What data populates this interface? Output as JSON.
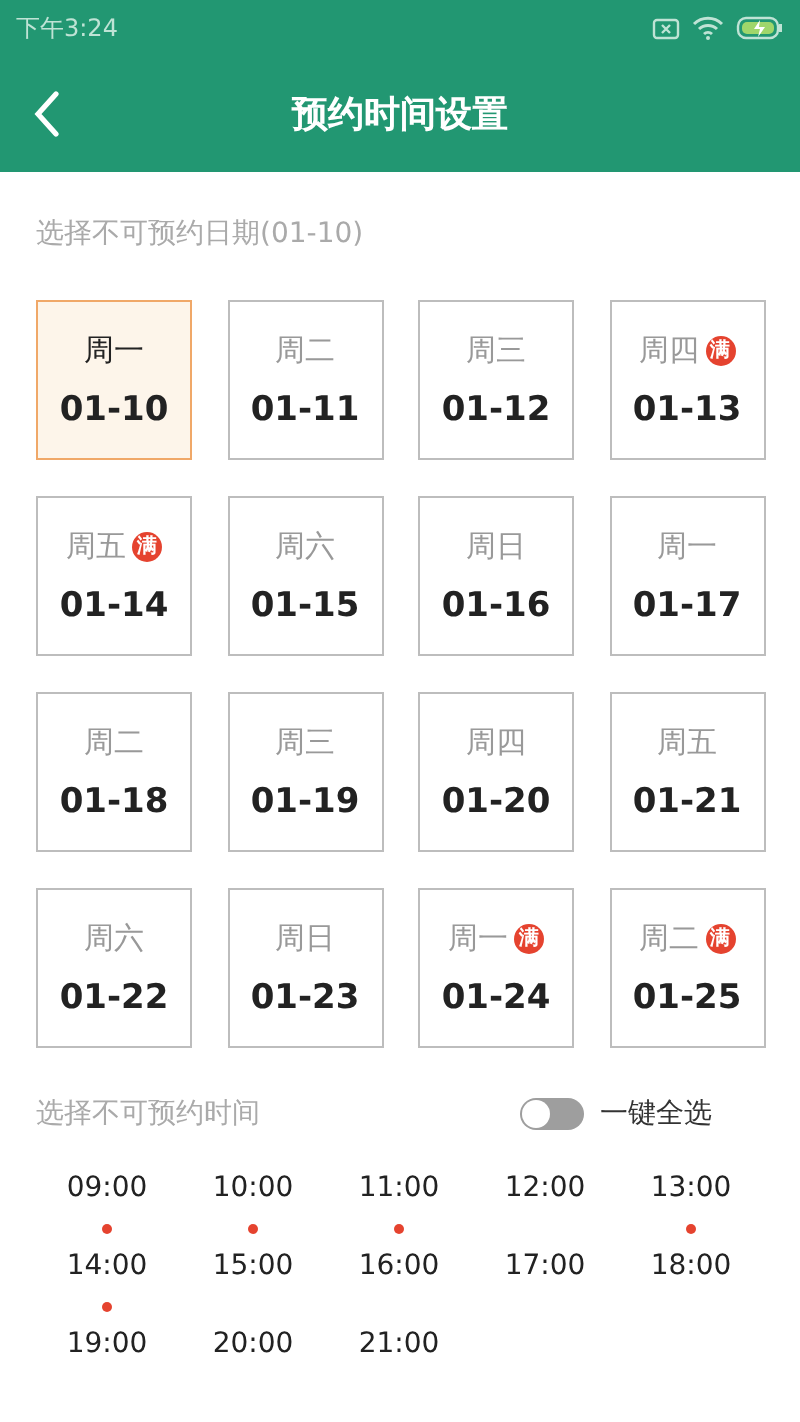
{
  "status_bar": {
    "time": "下午3:24"
  },
  "header": {
    "title": "预约时间设置"
  },
  "date_section": {
    "label": "选择不可预约日期(01-10)"
  },
  "dates": [
    {
      "weekday": "周一",
      "date": "01-10",
      "selected": true
    },
    {
      "weekday": "周二",
      "date": "01-11",
      "selected": false
    },
    {
      "weekday": "周三",
      "date": "01-12",
      "selected": false
    },
    {
      "weekday": "周四",
      "date": "01-13",
      "selected": false,
      "badge": "满"
    },
    {
      "weekday": "周五",
      "date": "01-14",
      "selected": false,
      "badge": "满"
    },
    {
      "weekday": "周六",
      "date": "01-15",
      "selected": false
    },
    {
      "weekday": "周日",
      "date": "01-16",
      "selected": false
    },
    {
      "weekday": "周一",
      "date": "01-17",
      "selected": false
    },
    {
      "weekday": "周二",
      "date": "01-18",
      "selected": false
    },
    {
      "weekday": "周三",
      "date": "01-19",
      "selected": false
    },
    {
      "weekday": "周四",
      "date": "01-20",
      "selected": false
    },
    {
      "weekday": "周五",
      "date": "01-21",
      "selected": false
    },
    {
      "weekday": "周六",
      "date": "01-22",
      "selected": false
    },
    {
      "weekday": "周日",
      "date": "01-23",
      "selected": false
    },
    {
      "weekday": "周一",
      "date": "01-24",
      "selected": false,
      "badge": "满"
    },
    {
      "weekday": "周二",
      "date": "01-25",
      "selected": false,
      "badge": "满"
    }
  ],
  "time_section": {
    "label": "选择不可预约时间",
    "select_all": {
      "label": "一键全选",
      "on": false
    }
  },
  "times": [
    {
      "time": "09:00",
      "marked": true
    },
    {
      "time": "10:00",
      "marked": true
    },
    {
      "time": "11:00",
      "marked": true
    },
    {
      "time": "12:00",
      "marked": false
    },
    {
      "time": "13:00",
      "marked": true
    },
    {
      "time": "14:00",
      "marked": true
    },
    {
      "time": "15:00",
      "marked": false
    },
    {
      "time": "16:00",
      "marked": false
    },
    {
      "time": "17:00",
      "marked": false
    },
    {
      "time": "18:00",
      "marked": false
    },
    {
      "time": "19:00",
      "marked": false
    },
    {
      "time": "20:00",
      "marked": false
    },
    {
      "time": "21:00",
      "marked": false
    }
  ]
}
